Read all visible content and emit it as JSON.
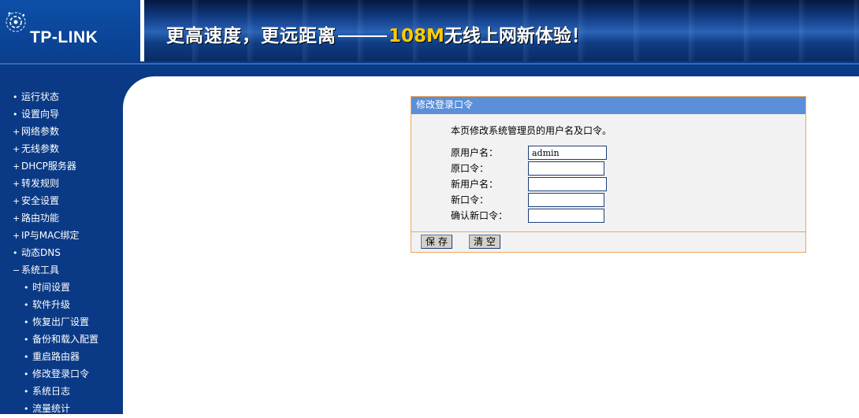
{
  "header": {
    "logo_text": "TP-LINK",
    "slogan_part1": "更高速度，更远距离",
    "slogan_number": "108M",
    "slogan_part2": "无线上网新体验！"
  },
  "sidebar": {
    "items": [
      {
        "bullet": "•",
        "label": "运行状态"
      },
      {
        "bullet": "•",
        "label": "设置向导"
      },
      {
        "bullet": "+",
        "label": "网络参数"
      },
      {
        "bullet": "+",
        "label": "无线参数"
      },
      {
        "bullet": "+",
        "label": "DHCP服务器"
      },
      {
        "bullet": "+",
        "label": "转发规则"
      },
      {
        "bullet": "+",
        "label": "安全设置"
      },
      {
        "bullet": "+",
        "label": "路由功能"
      },
      {
        "bullet": "+",
        "label": "IP与MAC绑定"
      },
      {
        "bullet": "•",
        "label": "动态DNS"
      },
      {
        "bullet": "−",
        "label": "系统工具"
      },
      {
        "bullet": "•",
        "label": "时间设置"
      },
      {
        "bullet": "•",
        "label": "软件升级"
      },
      {
        "bullet": "•",
        "label": "恢复出厂设置"
      },
      {
        "bullet": "•",
        "label": "备份和载入配置"
      },
      {
        "bullet": "•",
        "label": "重启路由器"
      },
      {
        "bullet": "•",
        "label": "修改登录口令"
      },
      {
        "bullet": "•",
        "label": "系统日志"
      },
      {
        "bullet": "•",
        "label": "流量统计"
      }
    ]
  },
  "form": {
    "title": "修改登录口令",
    "description": "本页修改系统管理员的用户名及口令。",
    "old_username_label": "原用户名：",
    "old_username_value": "admin",
    "old_password_label": "原口令：",
    "old_password_value": "",
    "new_username_label": "新用户名：",
    "new_username_value": "",
    "new_password_label": "新口令：",
    "new_password_value": "",
    "confirm_password_label": "确认新口令：",
    "confirm_password_value": "",
    "save_label": "保 存",
    "clear_label": "清 空"
  },
  "colors": {
    "nav_background": "#0a3a86",
    "panel_title_background": "#5b8fd9",
    "panel_border": "#f0a456",
    "slogan_accent": "#ffcc00"
  },
  "icons": [
    "tp-link-logo-icon",
    "bullet-icon",
    "expand-icon",
    "collapse-icon"
  ]
}
